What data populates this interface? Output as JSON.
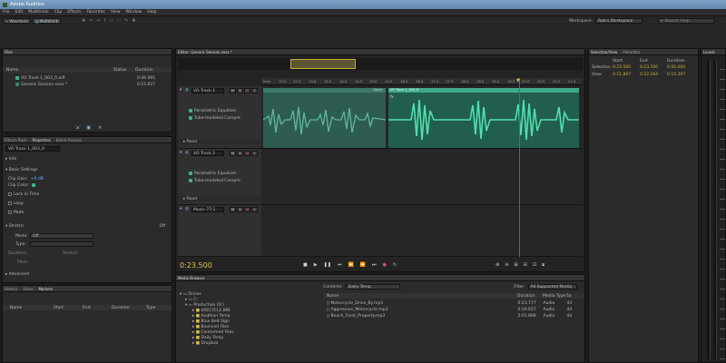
{
  "window": {
    "title": "Adobe Audition"
  },
  "menu": [
    "File",
    "Edit",
    "Multitrack",
    "Clip",
    "Effects",
    "Favorites",
    "View",
    "Window",
    "Help"
  ],
  "toolbar": {
    "waveform": "Waveform",
    "multitrack": "Multitrack",
    "workspace_label": "Workspace:",
    "workspace_value": "Rob's Workspace",
    "search_placeholder": "Search Help"
  },
  "files_panel": {
    "tab": "Files",
    "columns": [
      "Name",
      "Status",
      "Duration"
    ],
    "items": [
      {
        "name": "VO Track 1_003_R.aiff",
        "duration": "0:46.995"
      },
      {
        "name": "Generic Session.sesx *",
        "duration": "0:15.627"
      }
    ]
  },
  "properties_panel": {
    "tabs": [
      "Effects Rack",
      "Properties",
      "Batch Process"
    ],
    "clip_name": "VO Track 1_003_R",
    "sections": {
      "info": "Info",
      "basic": "Basic Settings",
      "stretch": "Stretch",
      "advanced": "Advanced"
    },
    "clip_gain_label": "Clip Gain:",
    "clip_gain_value": "+0 dB",
    "clip_color_label": "Clip Color:",
    "lock_in_time": "Lock in Time",
    "loop": "Loop",
    "mute": "Mute",
    "stretch_state": "Off",
    "mode_label": "Mode:",
    "mode_value": "Off",
    "type_label": "Type:",
    "duration_label": "Duration:",
    "stretch_label": "Stretch:",
    "pitch_label": "Pitch:"
  },
  "bottom_left": {
    "tabs": [
      "History",
      "Video",
      "Markers"
    ],
    "columns": [
      "Name",
      "Start",
      "End",
      "Duration",
      "Type"
    ]
  },
  "editor": {
    "tab": "Editor: Generic Session.sesx *",
    "timecode": "0:23.500",
    "ticks": [
      "hms",
      "12.0",
      "12.5",
      "13.0",
      "13.5",
      "14.0",
      "14.5",
      "15.0",
      "15.5",
      "16.0",
      "16.5",
      "17.0",
      "17.5",
      "18.0",
      "18.5",
      "19.0",
      "19.5",
      "20.0",
      "20.5",
      "21.0",
      "21.5"
    ],
    "tracks": [
      {
        "name": "VO Track 1",
        "effects": [
          "Parametric Equalizer",
          "Tube-modeled Compre"
        ],
        "read": "Read",
        "clip_a": "Voice",
        "clip_b": "VO Track 1_003_R"
      },
      {
        "name": "VO Track 2",
        "effects": [
          "Parametric Equalizer",
          "Tube-modeled Compre"
        ],
        "read": "Read"
      },
      {
        "name": "Music 77:1",
        "effects": [],
        "read": ""
      }
    ]
  },
  "selection_panel": {
    "tabs": [
      "Selection/View",
      "Metadata"
    ],
    "columns": [
      "Start",
      "End",
      "Duration"
    ],
    "rows": [
      {
        "label": "Selection",
        "start": "0:23.500",
        "end": "0:23.500",
        "duration": "0:00.000"
      },
      {
        "label": "View",
        "start": "0:11.867",
        "end": "0:22.264",
        "duration": "0:10.397"
      }
    ]
  },
  "levels_panel": {
    "tab": "Levels"
  },
  "media_browser": {
    "tab": "Media Browser",
    "contents_label": "Contents:",
    "contents_value": "Daily Temp",
    "filter_label": "Filter:",
    "filter_value": "All Supported Media",
    "columns": [
      "Name",
      "Duration",
      "Media Type",
      "Sa"
    ],
    "files": [
      {
        "name": "Motorcycle_Drive_By.mp3",
        "duration": "0:23.777",
        "type": "Audio",
        "sr": "44"
      },
      {
        "name": "Aggressive_Motorcycle.mp3",
        "duration": "0:29.657",
        "type": "Audio",
        "sr": "44"
      },
      {
        "name": "Beach_Front_Property.mp3",
        "duration": "2:01.808",
        "type": "Audio",
        "sr": "44"
      }
    ],
    "tree": [
      "Drives",
      "C:",
      "Production (D:)",
      "$RECYCLE.BIN",
      "Audition Temp",
      "Blue Belt Sign",
      "Bounced Files",
      "Conformed Files",
      "Daily Temp",
      "Dropbox"
    ]
  }
}
